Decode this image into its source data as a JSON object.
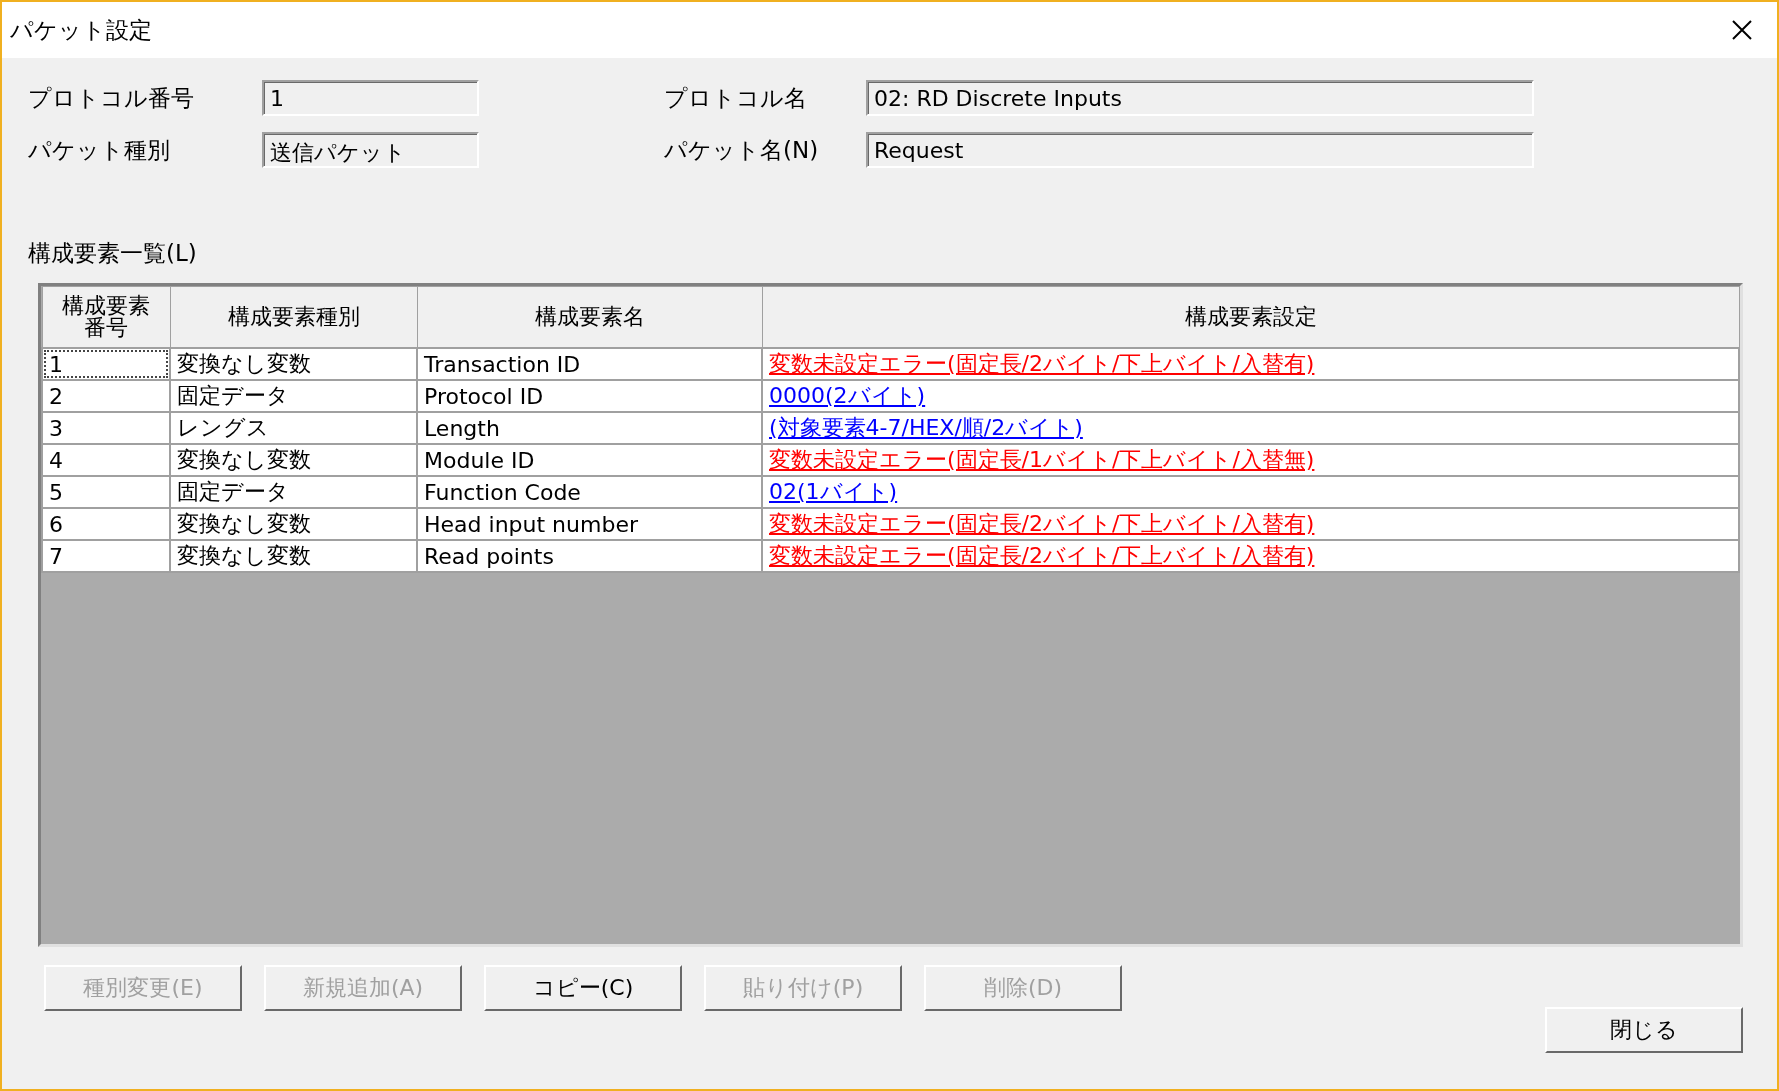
{
  "window": {
    "title": "パケット設定"
  },
  "fields": [
    {
      "label": "プロトコル番号",
      "value": "1"
    },
    {
      "label": "プロトコル名",
      "value": "02: RD Discrete Inputs"
    },
    {
      "label": "パケット種別",
      "value": "送信パケット"
    },
    {
      "label": "パケット名(N)",
      "value": "Request"
    }
  ],
  "list_label": "構成要素一覧(L)",
  "table": {
    "columns": [
      "構成要素番号",
      "構成要素種別",
      "構成要素名",
      "構成要素設定"
    ],
    "rows": [
      {
        "cells": [
          "1",
          "変換なし変数",
          "Transaction ID",
          "変数未設定エラー(固定長/2バイト/下上バイト/入替有)"
        ],
        "kind": "error",
        "focused": true
      },
      {
        "cells": [
          "2",
          "固定データ",
          "Protocol ID",
          "0000(2バイト)"
        ],
        "kind": "link",
        "focused": false
      },
      {
        "cells": [
          "3",
          "レングス",
          "Length",
          "(対象要素4-7/HEX/順/2バイト)"
        ],
        "kind": "link",
        "focused": false
      },
      {
        "cells": [
          "4",
          "変換なし変数",
          "Module ID",
          "変数未設定エラー(固定長/1バイト/下上バイト/入替無)"
        ],
        "kind": "error",
        "focused": false
      },
      {
        "cells": [
          "5",
          "固定データ",
          "Function Code",
          "02(1バイト)"
        ],
        "kind": "link",
        "focused": false
      },
      {
        "cells": [
          "6",
          "変換なし変数",
          "Head input number",
          "変数未設定エラー(固定長/2バイト/下上バイト/入替有)"
        ],
        "kind": "error",
        "focused": false
      },
      {
        "cells": [
          "7",
          "変換なし変数",
          "Read points",
          "変数未設定エラー(固定長/2バイト/下上バイト/入替有)"
        ],
        "kind": "error",
        "focused": false
      }
    ]
  },
  "buttons": [
    {
      "label": "種別変更(E)",
      "disabled": true
    },
    {
      "label": "新規追加(A)",
      "disabled": true
    },
    {
      "label": "コピー(C)",
      "disabled": false
    },
    {
      "label": "貼り付け(P)",
      "disabled": true
    },
    {
      "label": "削除(D)",
      "disabled": true
    }
  ],
  "close_button": "閉じる"
}
